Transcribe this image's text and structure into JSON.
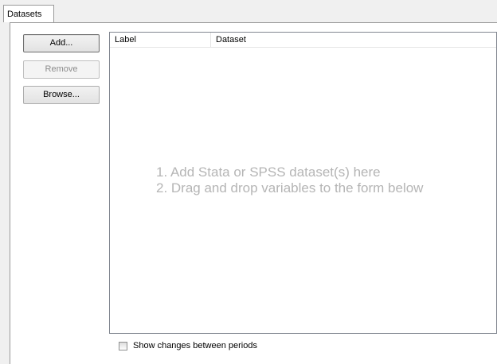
{
  "tabs": [
    {
      "label": "Datasets",
      "active": true
    }
  ],
  "buttons": {
    "add_label": "Add...",
    "remove_label": "Remove",
    "browse_label": "Browse..."
  },
  "grid": {
    "columns": [
      "Label",
      "Dataset"
    ],
    "rows": [],
    "empty_hint": {
      "line1": "1. Add Stata or SPSS dataset(s) here",
      "line2": "2. Drag and drop variables to the form below"
    }
  },
  "options": {
    "show_changes_label": "Show changes between periods",
    "show_changes_checked": false
  },
  "colors": {
    "hint_text": "#b5b5b5",
    "panel_background": "#ffffff",
    "window_background": "#f0f0f0"
  }
}
